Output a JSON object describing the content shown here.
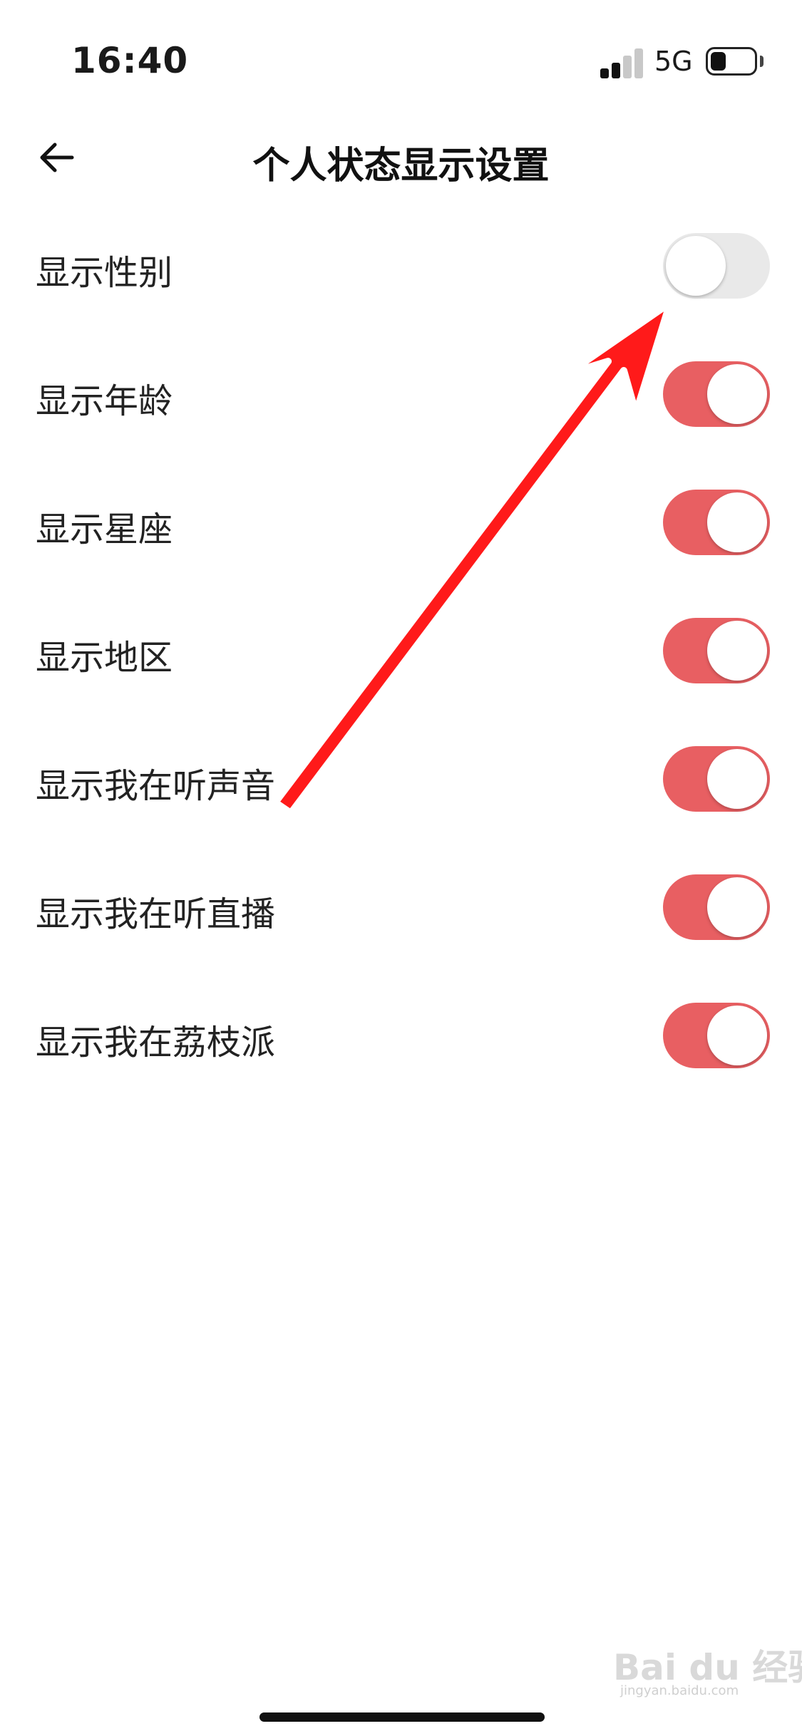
{
  "status_bar": {
    "time": "16:40",
    "network": "5G",
    "signal_level": 0.5,
    "battery_level": 0.35
  },
  "header": {
    "back_icon": "arrow-left-icon",
    "title": "个人状态显示设置"
  },
  "settings": [
    {
      "label": "显示性别",
      "enabled": false
    },
    {
      "label": "显示年龄",
      "enabled": true
    },
    {
      "label": "显示星座",
      "enabled": true
    },
    {
      "label": "显示地区",
      "enabled": true
    },
    {
      "label": "显示我在听声音",
      "enabled": true
    },
    {
      "label": "显示我在听直播",
      "enabled": true
    },
    {
      "label": "显示我在荔枝派",
      "enabled": true
    }
  ],
  "colors": {
    "toggle_on": "#e85f62",
    "toggle_off": "#e9e9e9",
    "annotation_arrow": "#ff1a1a"
  },
  "watermark": {
    "brand": "Bai du 经验",
    "url": "jingyan.baidu.com"
  }
}
